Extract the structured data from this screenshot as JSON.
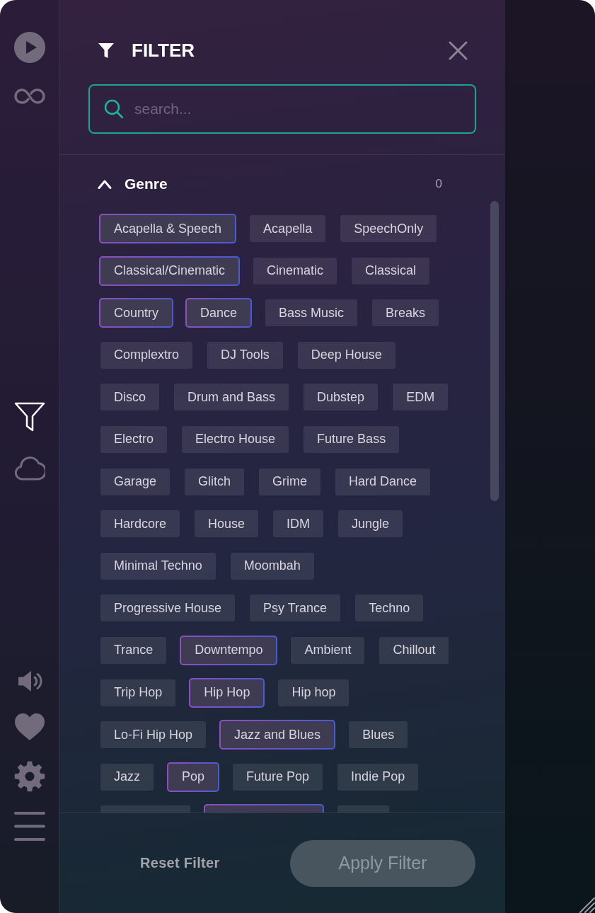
{
  "sidebar": {
    "top_items": [
      {
        "selected": false
      },
      {
        "selected": false
      }
    ],
    "middle_items": [
      {
        "selected": true
      },
      {
        "selected": false
      }
    ],
    "bottom_items": [
      {
        "selected": false
      },
      {
        "selected": false
      },
      {
        "selected": false
      },
      {
        "selected": false
      }
    ]
  },
  "header": {
    "title": "FILTER"
  },
  "search": {
    "placeholder": "search..."
  },
  "genre": {
    "title": "Genre",
    "count": "0",
    "expanded": true,
    "tags": [
      {
        "label": "Acapella & Speech",
        "selected": true
      },
      {
        "label": "Acapella",
        "selected": false
      },
      {
        "label": "SpeechOnly",
        "selected": false
      },
      {
        "label": "Classical/Cinematic",
        "selected": true
      },
      {
        "label": "Cinematic",
        "selected": false
      },
      {
        "label": "Classical",
        "selected": false
      },
      {
        "label": "Country",
        "selected": true
      },
      {
        "label": "Dance",
        "selected": true
      },
      {
        "label": "Bass Music",
        "selected": false
      },
      {
        "label": "Breaks",
        "selected": false
      },
      {
        "label": "Complextro",
        "selected": false
      },
      {
        "label": "DJ Tools",
        "selected": false
      },
      {
        "label": "Deep House",
        "selected": false
      },
      {
        "label": "Disco",
        "selected": false
      },
      {
        "label": "Drum and Bass",
        "selected": false
      },
      {
        "label": "Dubstep",
        "selected": false
      },
      {
        "label": "EDM",
        "selected": false
      },
      {
        "label": "Electro",
        "selected": false
      },
      {
        "label": "Electro House",
        "selected": false
      },
      {
        "label": "Future Bass",
        "selected": false
      },
      {
        "label": "Garage",
        "selected": false
      },
      {
        "label": "Glitch",
        "selected": false
      },
      {
        "label": "Grime",
        "selected": false
      },
      {
        "label": "Hard Dance",
        "selected": false
      },
      {
        "label": "Hardcore",
        "selected": false
      },
      {
        "label": "House",
        "selected": false
      },
      {
        "label": "IDM",
        "selected": false
      },
      {
        "label": "Jungle",
        "selected": false
      },
      {
        "label": "Minimal Techno",
        "selected": false
      },
      {
        "label": "Moombah",
        "selected": false
      },
      {
        "label": "Progressive House",
        "selected": false
      },
      {
        "label": "Psy Trance",
        "selected": false
      },
      {
        "label": "Techno",
        "selected": false
      },
      {
        "label": "Trance",
        "selected": false
      },
      {
        "label": "Downtempo",
        "selected": true
      },
      {
        "label": "Ambient",
        "selected": false
      },
      {
        "label": "Chillout",
        "selected": false
      },
      {
        "label": "Trip Hop",
        "selected": false
      },
      {
        "label": "Hip Hop",
        "selected": true
      },
      {
        "label": "Hip hop",
        "selected": false
      },
      {
        "label": "Lo-Fi Hip Hop",
        "selected": false
      },
      {
        "label": "Jazz and Blues",
        "selected": true
      },
      {
        "label": "Blues",
        "selected": false
      },
      {
        "label": "Jazz",
        "selected": false
      },
      {
        "label": "Pop",
        "selected": true
      },
      {
        "label": "Future Pop",
        "selected": false
      },
      {
        "label": "Indie Pop",
        "selected": false
      }
    ],
    "partial_tags": [
      {
        "selected": false
      },
      {
        "selected": true
      },
      {
        "selected": false
      }
    ]
  },
  "footer": {
    "reset_label": "Reset Filter",
    "apply": {
      "label": "Apply Filter",
      "disabled": true
    }
  }
}
